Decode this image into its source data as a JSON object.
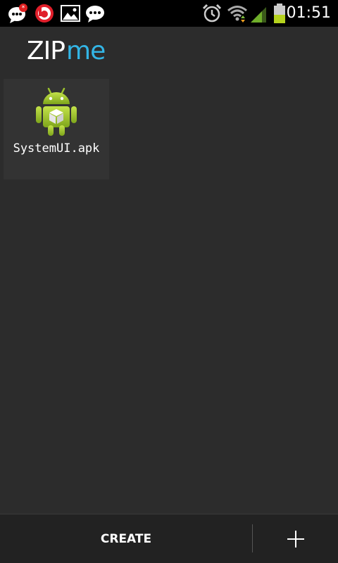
{
  "status_bar": {
    "time": "01:51",
    "notification_icons": [
      "chat-bubble-alert-icon",
      "beats-icon",
      "image-icon",
      "chat-bubble-icon"
    ],
    "system_icons": [
      "alarm-icon",
      "wifi-icon",
      "signal-icon",
      "battery-icon"
    ]
  },
  "header": {
    "logo_part1": "ZIP",
    "logo_part2": "me"
  },
  "files": [
    {
      "name": "SystemUI.apk",
      "icon": "android-package-icon"
    }
  ],
  "bottom_bar": {
    "create_label": "CREATE",
    "add_icon": "plus-icon"
  },
  "colors": {
    "accent": "#33b5e5",
    "background": "#2c2c2c",
    "status_bar": "#000000",
    "android_green": "#a4c639"
  }
}
